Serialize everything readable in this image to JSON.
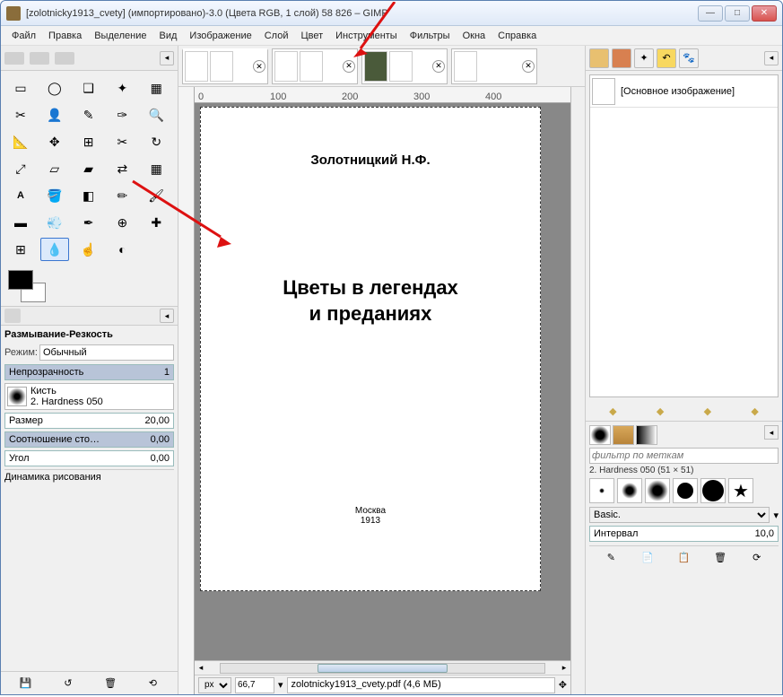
{
  "window": {
    "title": "[zolotnicky1913_cvety] (импортировано)-3.0 (Цвета RGB, 1 слой) 58  826 – GIMP"
  },
  "menu": {
    "file": "Файл",
    "edit": "Правка",
    "select": "Выделение",
    "view": "Вид",
    "image": "Изображение",
    "layer": "Слой",
    "colors": "Цвет",
    "tools": "Инструменты",
    "filters": "Фильтры",
    "windows": "Окна",
    "help": "Справка"
  },
  "tool_options": {
    "title": "Размывание-Резкость",
    "mode_label": "Режим:",
    "mode_value": "Обычный",
    "opacity_label": "Непрозрачность",
    "opacity_value": "1",
    "brush_label": "Кисть",
    "brush_name": "2. Hardness 050",
    "size_label": "Размер",
    "size_value": "20,00",
    "aspect_label": "Соотношение сто…",
    "aspect_value": "0,00",
    "angle_label": "Угол",
    "angle_value": "0,00",
    "dynamics_label": "Динамика рисования"
  },
  "document": {
    "author": "Золотницкий Н.Ф.",
    "title": "Цветы в легендах\nи преданиях",
    "city": "Москва",
    "year": "1913"
  },
  "status": {
    "unit": "px",
    "zoom": "66,7",
    "filename": "zolotnicky1913_cvety.pdf (4,6 МБ)"
  },
  "right": {
    "layer_name": "[Основное изображение]",
    "brush_filter_placeholder": "фильтр по меткам",
    "brush_current": "2. Hardness 050 (51 × 51)",
    "preset": "Basic.",
    "spacing_label": "Интервал",
    "spacing_value": "10,0"
  },
  "ruler_h": [
    "0",
    "100",
    "200",
    "300",
    "400"
  ]
}
